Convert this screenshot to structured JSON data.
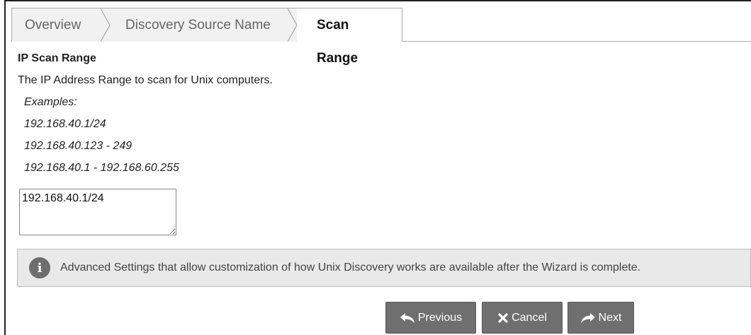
{
  "tabs": [
    {
      "label": "Overview"
    },
    {
      "label": "Discovery Source Name"
    },
    {
      "label": "Scan Range"
    }
  ],
  "section": {
    "heading": "IP Scan Range",
    "description": "The IP Address Range to scan for Unix computers.",
    "examples_label": "Examples:",
    "examples": [
      "192.168.40.1/24",
      "192.168.40.123 - 249",
      "192.168.40.1 - 192.168.60.255"
    ]
  },
  "range_input": {
    "value": "192.168.40.1/24"
  },
  "info": {
    "icon": "info-icon",
    "text": "Advanced Settings that allow customization of how Unix Discovery works are available after the Wizard is complete."
  },
  "buttons": {
    "previous": "Previous",
    "cancel": "Cancel",
    "next": "Next"
  },
  "colors": {
    "button_bg": "#6f6f6f",
    "info_bg": "#e9e9e9",
    "tab_bg": "#f1f1f1"
  }
}
